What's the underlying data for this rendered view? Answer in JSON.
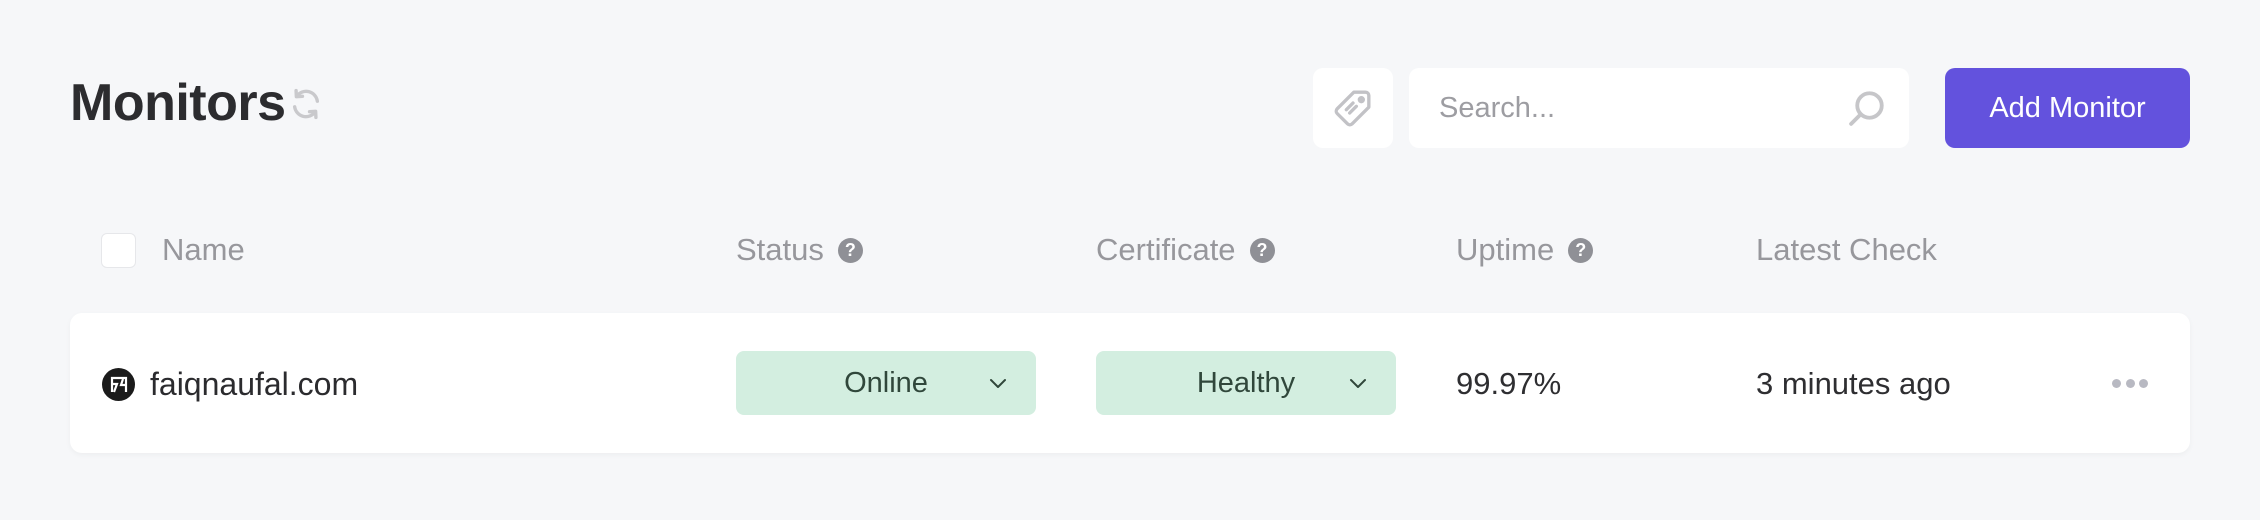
{
  "header": {
    "title": "Monitors",
    "refresh_icon": "refresh-icon",
    "tag_icon": "tag-icon",
    "search": {
      "placeholder": "Search...",
      "value": "",
      "icon": "search-icon"
    },
    "add_button": "Add Monitor"
  },
  "colors": {
    "accent": "#6352dd",
    "status_bg": "#d3eee0",
    "status_text": "#30473b",
    "page_bg": "#f6f7f9"
  },
  "table": {
    "columns": [
      {
        "label": "Name",
        "help": false
      },
      {
        "label": "Status",
        "help": true
      },
      {
        "label": "Certificate",
        "help": true
      },
      {
        "label": "Uptime",
        "help": true
      },
      {
        "label": "Latest Check",
        "help": false
      }
    ],
    "help_glyph": "?",
    "rows": [
      {
        "name": "faiqnaufal.com",
        "status": "Online",
        "certificate": "Healthy",
        "uptime": "99.97%",
        "latest_check": "3 minutes ago"
      }
    ]
  }
}
